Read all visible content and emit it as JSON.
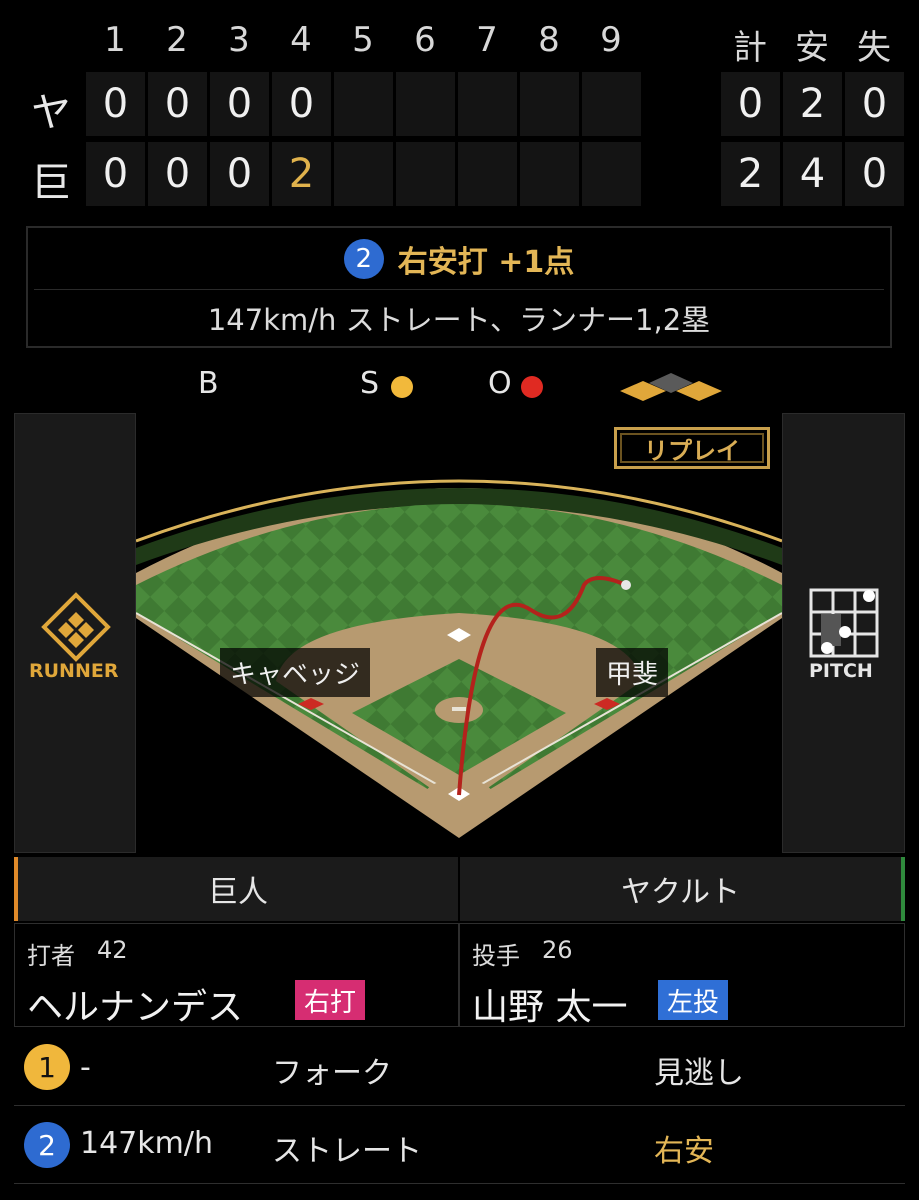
{
  "scoreboard": {
    "innings": [
      "1",
      "2",
      "3",
      "4",
      "5",
      "6",
      "7",
      "8",
      "9"
    ],
    "total_headers": [
      "計",
      "安",
      "失"
    ],
    "teams": [
      {
        "abbr": "ヤ",
        "scores": [
          "0",
          "0",
          "0",
          "0",
          "",
          "",
          "",
          "",
          ""
        ],
        "totals": [
          "0",
          "2",
          "0"
        ]
      },
      {
        "abbr": "巨",
        "scores": [
          "0",
          "0",
          "0",
          "2",
          "",
          "",
          "",
          "",
          ""
        ],
        "totals": [
          "2",
          "4",
          "0"
        ]
      }
    ]
  },
  "current_play": {
    "number": "2",
    "result": "右安打 +1点",
    "detail": "147km/h ストレート、ランナー1,2塁"
  },
  "count": {
    "ball_label": "B",
    "strike_label": "S",
    "out_label": "O",
    "strikes": 1,
    "outs": 1,
    "runners_on": [
      "1B",
      "2B"
    ]
  },
  "field": {
    "replay_label": "リプレイ",
    "fielder_left": "キャベッジ",
    "fielder_right": "甲斐",
    "runner_label": "RUNNER",
    "pitch_label": "PITCH"
  },
  "tabs": {
    "home": "巨人",
    "away": "ヤクルト"
  },
  "batter": {
    "role": "打者",
    "number": "42",
    "name": "ヘルナンデス",
    "hand": "右打"
  },
  "pitcher": {
    "role": "投手",
    "number": "26",
    "name": "山野 太一",
    "hand": "左投"
  },
  "pitches": [
    {
      "num": "1",
      "speed": "-",
      "type": "フォーク",
      "result": "見逃し"
    },
    {
      "num": "2",
      "speed": "147km/h",
      "type": "ストレート",
      "result": "右安"
    }
  ],
  "colors": {
    "accent_gold": "#e3b656",
    "strike": "#f2b93b",
    "out": "#e02a22",
    "badge_blue": "#2e6bd1",
    "batter_hand": "#d62d72",
    "pitcher_hand": "#2f6fd6"
  }
}
